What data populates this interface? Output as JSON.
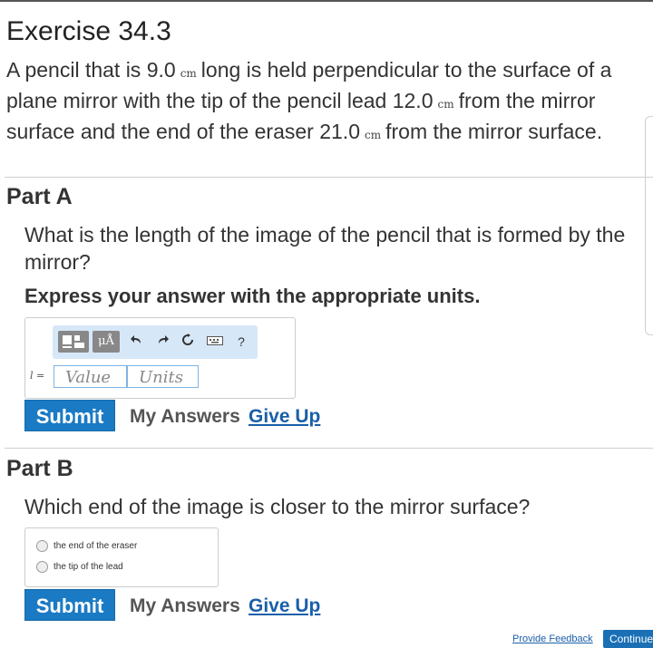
{
  "exercise": {
    "title": "Exercise 34.3",
    "problem_segments": [
      "A pencil that is 9.0",
      "cm",
      "long is held perpendicular to the surface of a plane mirror with the tip of the pencil lead 12.0",
      "cm",
      "from the mirror surface and the end of the eraser 21.0",
      "cm",
      "from the mirror surface."
    ]
  },
  "part_a": {
    "title": "Part A",
    "question": "What is the length of the image of the pencil that is formed by the mirror?",
    "instruction": "Express your answer with the appropriate units.",
    "toolbar": {
      "templates_icon": "templates-icon",
      "units_button": "μÅ",
      "undo_icon": "undo-icon",
      "redo_icon": "redo-icon",
      "reset_icon": "reset-icon",
      "keyboard_icon": "keyboard-icon",
      "help_label": "?"
    },
    "variable_label": "l =",
    "value_placeholder": "Value",
    "units_placeholder": "Units",
    "submit_label": "Submit",
    "my_answers_label": "My Answers",
    "give_up_label": "Give Up"
  },
  "part_b": {
    "title": "Part B",
    "question": "Which end of the image is closer to the mirror surface?",
    "options": [
      "the end of the eraser",
      "the tip of the lead"
    ],
    "submit_label": "Submit",
    "my_answers_label": "My Answers",
    "give_up_label": "Give Up"
  },
  "footer": {
    "feedback_label": "Provide Feedback",
    "continue_label": "Continue"
  },
  "colors": {
    "submit": "#1a7ac4",
    "link": "#1a5fa8",
    "toolbar_bg": "#d6e7f8",
    "input_border": "#7fb4e2"
  }
}
